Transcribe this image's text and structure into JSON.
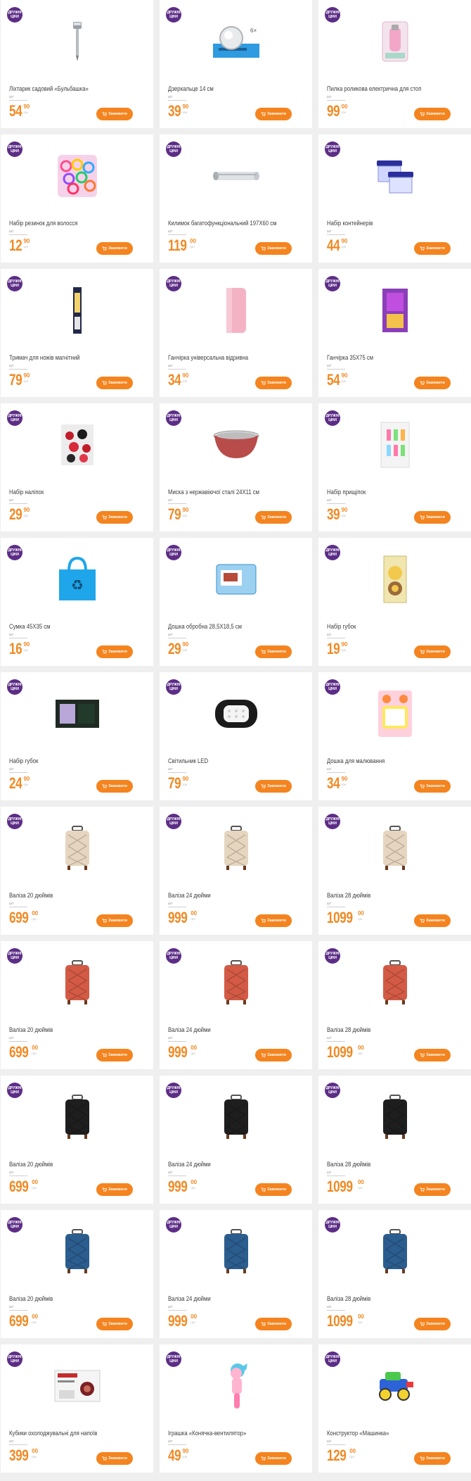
{
  "badge": {
    "line1": "ДРУЖНІ",
    "line2": "ЦІНИ"
  },
  "order_label": "Замовити",
  "unit_label": "шт",
  "currency_label": "грн",
  "colors": {
    "accent": "#f4841f",
    "price": "#f08a24",
    "badge": "#5c2d86",
    "background": "#efefef"
  },
  "products": [
    {
      "title": "Ліхтарик садовий «Бульбашка»",
      "price_int": "54",
      "price_dec": "90",
      "icon": "garden-lamp-icon"
    },
    {
      "title": "Дзеркальце 14 см",
      "price_int": "39",
      "price_dec": "90",
      "icon": "mirror-icon"
    },
    {
      "title": "Пилка роликова електрична для стоп",
      "price_int": "99",
      "price_dec": "00",
      "icon": "foot-file-icon"
    },
    {
      "title": "Набір резинок для волосся",
      "price_int": "12",
      "price_dec": "90",
      "icon": "hair-ties-icon"
    },
    {
      "title": "Килимок багатофункціональний 197Х60 см",
      "price_int": "119",
      "price_dec": "00",
      "icon": "mat-roll-icon"
    },
    {
      "title": "Набір контейнерів",
      "price_int": "44",
      "price_dec": "90",
      "icon": "containers-icon"
    },
    {
      "title": "Тримач для ножів магнітний",
      "price_int": "79",
      "price_dec": "90",
      "icon": "knife-holder-icon"
    },
    {
      "title": "Ганчірка універсальна відривна",
      "price_int": "34",
      "price_dec": "90",
      "icon": "cloth-roll-icon"
    },
    {
      "title": "Ганчірка 35Х75 см",
      "price_int": "54",
      "price_dec": "90",
      "icon": "cloth-icon"
    },
    {
      "title": "Набір наліпок",
      "price_int": "29",
      "price_dec": "90",
      "icon": "stickers-icon"
    },
    {
      "title": "Миска з нержавіючої сталі 24Х11 см",
      "price_int": "79",
      "price_dec": "90",
      "icon": "bowl-icon"
    },
    {
      "title": "Набір прищіпок",
      "price_int": "39",
      "price_dec": "90",
      "icon": "clothespins-icon"
    },
    {
      "title": "Сумка 45Х35 см",
      "price_int": "16",
      "price_dec": "90",
      "icon": "bag-icon"
    },
    {
      "title": "Дошка обробна 28,5Х18,5 см",
      "price_int": "29",
      "price_dec": "90",
      "icon": "cutting-board-icon"
    },
    {
      "title": "Набір губок",
      "price_int": "19",
      "price_dec": "90",
      "icon": "sponges-icon"
    },
    {
      "title": "Набір губок",
      "price_int": "24",
      "price_dec": "90",
      "icon": "sponge-pack-icon"
    },
    {
      "title": "Світильник LED",
      "price_int": "79",
      "price_dec": "90",
      "icon": "led-lamp-icon"
    },
    {
      "title": "Дошка для малювання",
      "price_int": "34",
      "price_dec": "90",
      "icon": "drawing-board-icon"
    },
    {
      "title": "Валіза 20 дюймів",
      "price_int": "699",
      "price_dec": "00",
      "icon": "suitcase-beige-icon",
      "color": "#e6d6c0"
    },
    {
      "title": "Валіза 24 дюйми",
      "price_int": "999",
      "price_dec": "00",
      "icon": "suitcase-beige-icon",
      "color": "#e6d6c0"
    },
    {
      "title": "Валіза 28 дюймів",
      "price_int": "1099",
      "price_dec": "00",
      "icon": "suitcase-beige-icon",
      "color": "#e6d6c0"
    },
    {
      "title": "Валіза 20 дюймів",
      "price_int": "699",
      "price_dec": "00",
      "icon": "suitcase-red-icon",
      "color": "#d35a45"
    },
    {
      "title": "Валіза 24 дюйми",
      "price_int": "999",
      "price_dec": "00",
      "icon": "suitcase-red-icon",
      "color": "#d35a45"
    },
    {
      "title": "Валіза 28 дюймів",
      "price_int": "1099",
      "price_dec": "00",
      "icon": "suitcase-red-icon",
      "color": "#d35a45"
    },
    {
      "title": "Валіза 20 дюймів",
      "price_int": "699",
      "price_dec": "00",
      "icon": "suitcase-black-icon",
      "color": "#1e1e1e"
    },
    {
      "title": "Валіза 24 дюйми",
      "price_int": "999",
      "price_dec": "00",
      "icon": "suitcase-black-icon",
      "color": "#1e1e1e"
    },
    {
      "title": "Валіза 28 дюймів",
      "price_int": "1099",
      "price_dec": "00",
      "icon": "suitcase-black-icon",
      "color": "#1e1e1e"
    },
    {
      "title": "Валіза 20 дюймів",
      "price_int": "699",
      "price_dec": "00",
      "icon": "suitcase-blue-icon",
      "color": "#2b5d8e"
    },
    {
      "title": "Валіза 24 дюйми",
      "price_int": "999",
      "price_dec": "00",
      "icon": "suitcase-blue-icon",
      "color": "#2b5d8e"
    },
    {
      "title": "Валіза 28 дюймів",
      "price_int": "1099",
      "price_dec": "00",
      "icon": "suitcase-blue-icon",
      "color": "#2b5d8e"
    },
    {
      "title": "Кубики охолоджувальні для напоїв",
      "price_int": "399",
      "price_dec": "00",
      "icon": "ice-cubes-icon"
    },
    {
      "title": "Іграшка «Конячка-вентилятор»",
      "price_int": "49",
      "price_dec": "90",
      "icon": "pony-fan-toy-icon"
    },
    {
      "title": "Конструктор «Машинка»",
      "price_int": "129",
      "price_dec": "00",
      "icon": "toy-car-constructor-icon"
    }
  ]
}
